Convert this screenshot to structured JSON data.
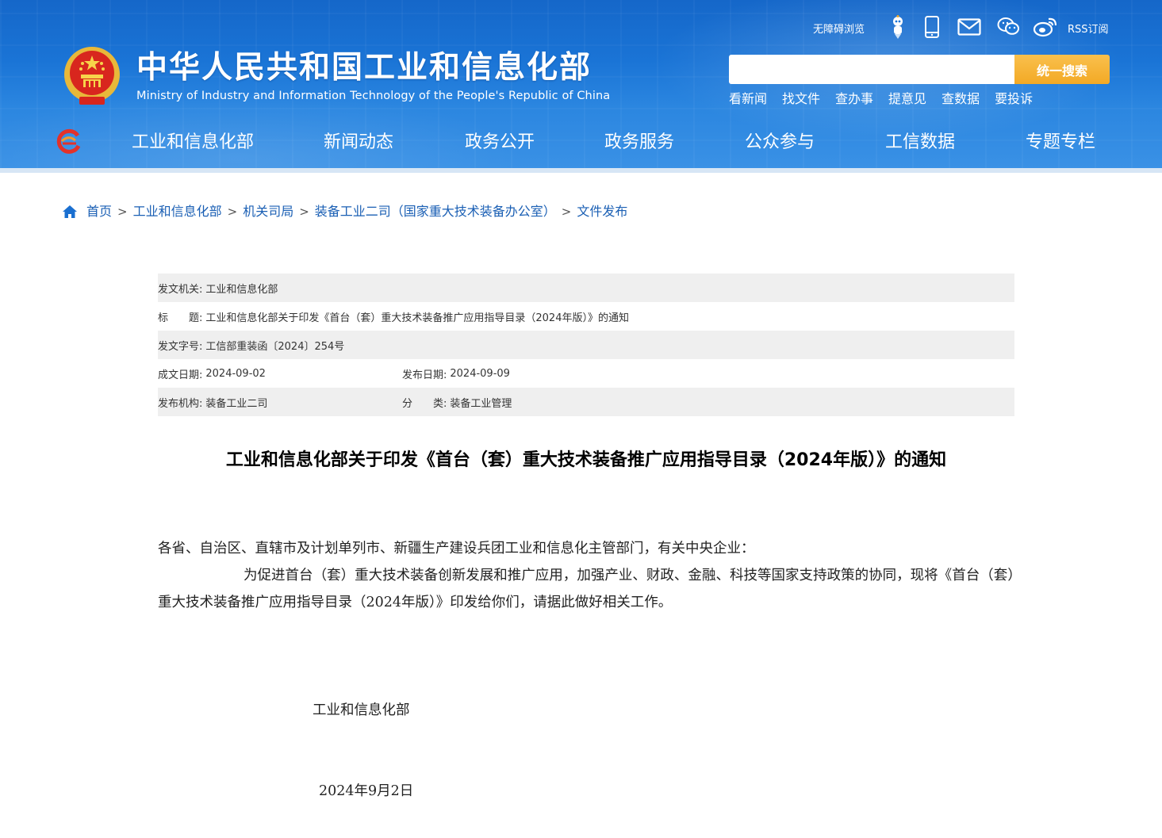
{
  "header": {
    "site_title": "中华人民共和国工业和信息化部",
    "site_subtitle": "Ministry of Industry and Information Technology of the People's Republic of China",
    "utility": {
      "accessible_label": "无障碍浏览",
      "rss_label": "RSS订阅",
      "icons": [
        "robot-assistant-icon",
        "mobile-icon",
        "mail-icon",
        "wechat-icon",
        "weibo-icon"
      ]
    },
    "search": {
      "placeholder": "",
      "button_label": "统一搜索"
    },
    "quick_links": [
      "看新闻",
      "找文件",
      "查办事",
      "提意见",
      "查数据",
      "要投诉"
    ],
    "nav": [
      "工业和信息化部",
      "新闻动态",
      "政务公开",
      "政务服务",
      "公众参与",
      "工信数据",
      "专题专栏"
    ],
    "colors": {
      "header_blue": "#1a74d6",
      "search_button": "#f3a925"
    }
  },
  "breadcrumb": [
    "首页",
    "工业和信息化部",
    "机关司局",
    "装备工业二司（国家重大技术装备办公室）",
    "文件发布"
  ],
  "meta": {
    "issuer_label": "发文机关:",
    "issuer": "工业和信息化部",
    "title_label": "标　　题:",
    "title": "工业和信息化部关于印发《首台（套）重大技术装备推广应用指导目录（2024年版）》的通知",
    "doc_no_label": "发文字号:",
    "doc_no": "工信部重装函〔2024〕254号",
    "written_date_label": "成文日期:",
    "written_date": "2024-09-02",
    "publish_date_label": "发布日期:",
    "publish_date": "2024-09-09",
    "publisher_label": "发布机构:",
    "publisher": "装备工业二司",
    "category_label": "分　　类:",
    "category": "装备工业管理"
  },
  "article": {
    "title": "工业和信息化部关于印发《首台（套）重大技术装备推广应用指导目录（2024年版）》的通知",
    "salutation": "各省、自治区、直辖市及计划单列市、新疆生产建设兵团工业和信息化主管部门，有关中央企业：",
    "paragraph": "为促进首台（套）重大技术装备创新发展和推广应用，加强产业、财政、金融、科技等国家支持政策的协同，现将《首台（套）重大技术装备推广应用指导目录（2024年版）》印发给你们，请据此做好相关工作。",
    "signature_org": "工业和信息化部",
    "signature_date": "2024年9月2日"
  }
}
